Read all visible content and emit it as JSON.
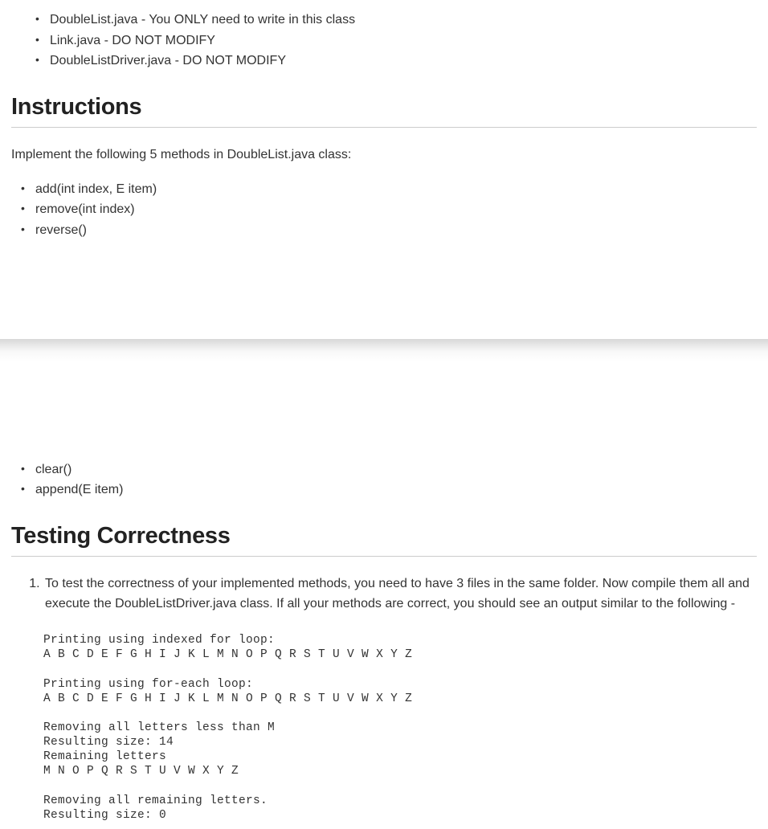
{
  "top_files": [
    "DoubleList.java - You ONLY need to write in this class",
    "Link.java - DO NOT MODIFY",
    "DoubleListDriver.java - DO NOT MODIFY"
  ],
  "instructions": {
    "heading": "Instructions",
    "intro": "Implement the following 5 methods in DoubleList.java class:",
    "methods_a": [
      "add(int index, E item)",
      "remove(int index)",
      "reverse()"
    ],
    "methods_b": [
      "clear()",
      "append(E item)"
    ]
  },
  "testing": {
    "heading": "Testing Correctness",
    "step1": "To test the correctness of your implemented methods, you need to have 3 files in the same folder. Now compile them all and execute the DoubleListDriver.java class. If all your methods are correct, you should see an output similar to the following -",
    "output": "Printing using indexed for loop:\nA B C D E F G H I J K L M N O P Q R S T U V W X Y Z\n\nPrinting using for-each loop:\nA B C D E F G H I J K L M N O P Q R S T U V W X Y Z\n\nRemoving all letters less than M\nResulting size: 14\nRemaining letters\nM N O P Q R S T U V W X Y Z\n\nRemoving all remaining letters.\nResulting size: 0"
  }
}
